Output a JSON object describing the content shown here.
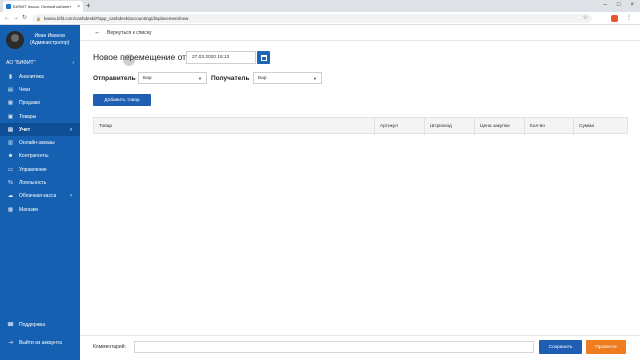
{
  "browser": {
    "tab_title": "БИФИТ Касса. Личный кабинет",
    "tab_close": "×",
    "new_tab": "+",
    "url": "kassa.bifit.com/cashdesk/#/app_cashdesk/accounting/displacement/new",
    "window_controls": [
      "–",
      "□",
      "×"
    ]
  },
  "sidebar": {
    "user_name_line1": "Иван Иванов",
    "user_name_line2": "(Администратор)",
    "org": "АО \"БИФИТ\"",
    "items": [
      {
        "label": "Аналитика",
        "icon": "chart-icon",
        "glyph": "▮"
      },
      {
        "label": "Чеки",
        "icon": "receipt-icon",
        "glyph": "▤"
      },
      {
        "label": "Продажи",
        "icon": "sales-icon",
        "glyph": "▦"
      },
      {
        "label": "Товары",
        "icon": "goods-icon",
        "glyph": "▣"
      },
      {
        "label": "Учет",
        "icon": "accounting-icon",
        "glyph": "▤",
        "active": true
      },
      {
        "label": "Онлайн-заказы",
        "icon": "online-orders-icon",
        "glyph": "▥"
      },
      {
        "label": "Контрагенты",
        "icon": "contractors-icon",
        "glyph": "☻"
      },
      {
        "label": "Управление",
        "icon": "management-icon",
        "glyph": "▭"
      },
      {
        "label": "Лояльность",
        "icon": "loyalty-icon",
        "glyph": "%"
      },
      {
        "label": "Облачная касса",
        "icon": "cloud-cashdesk-icon",
        "glyph": "☁"
      },
      {
        "label": "Магазин",
        "icon": "store-icon",
        "glyph": "▩"
      }
    ],
    "support": "Поддержка",
    "logout": "Выйти из аккаунта"
  },
  "main": {
    "back_label": "Вернуться к списку",
    "title": "Новое перемещение от",
    "date_value": "27.03.2020 15:13",
    "sender_label": "Отправитель",
    "sender_value": "Бар",
    "receiver_label": "Получатель",
    "receiver_value": "Бар",
    "add_button": "Добавить товар",
    "columns": [
      "Товар",
      "Артикул",
      "Штрихкод",
      "Цена закупки",
      "Кол-во",
      "Сумма"
    ],
    "comment_label": "Комментарий:",
    "comment_value": "",
    "save_button": "Сохранить",
    "post_button": "Провести"
  },
  "colors": {
    "sidebar_bg": "#1560b1",
    "primary": "#1e5fb4",
    "accent_orange": "#f07c20"
  }
}
